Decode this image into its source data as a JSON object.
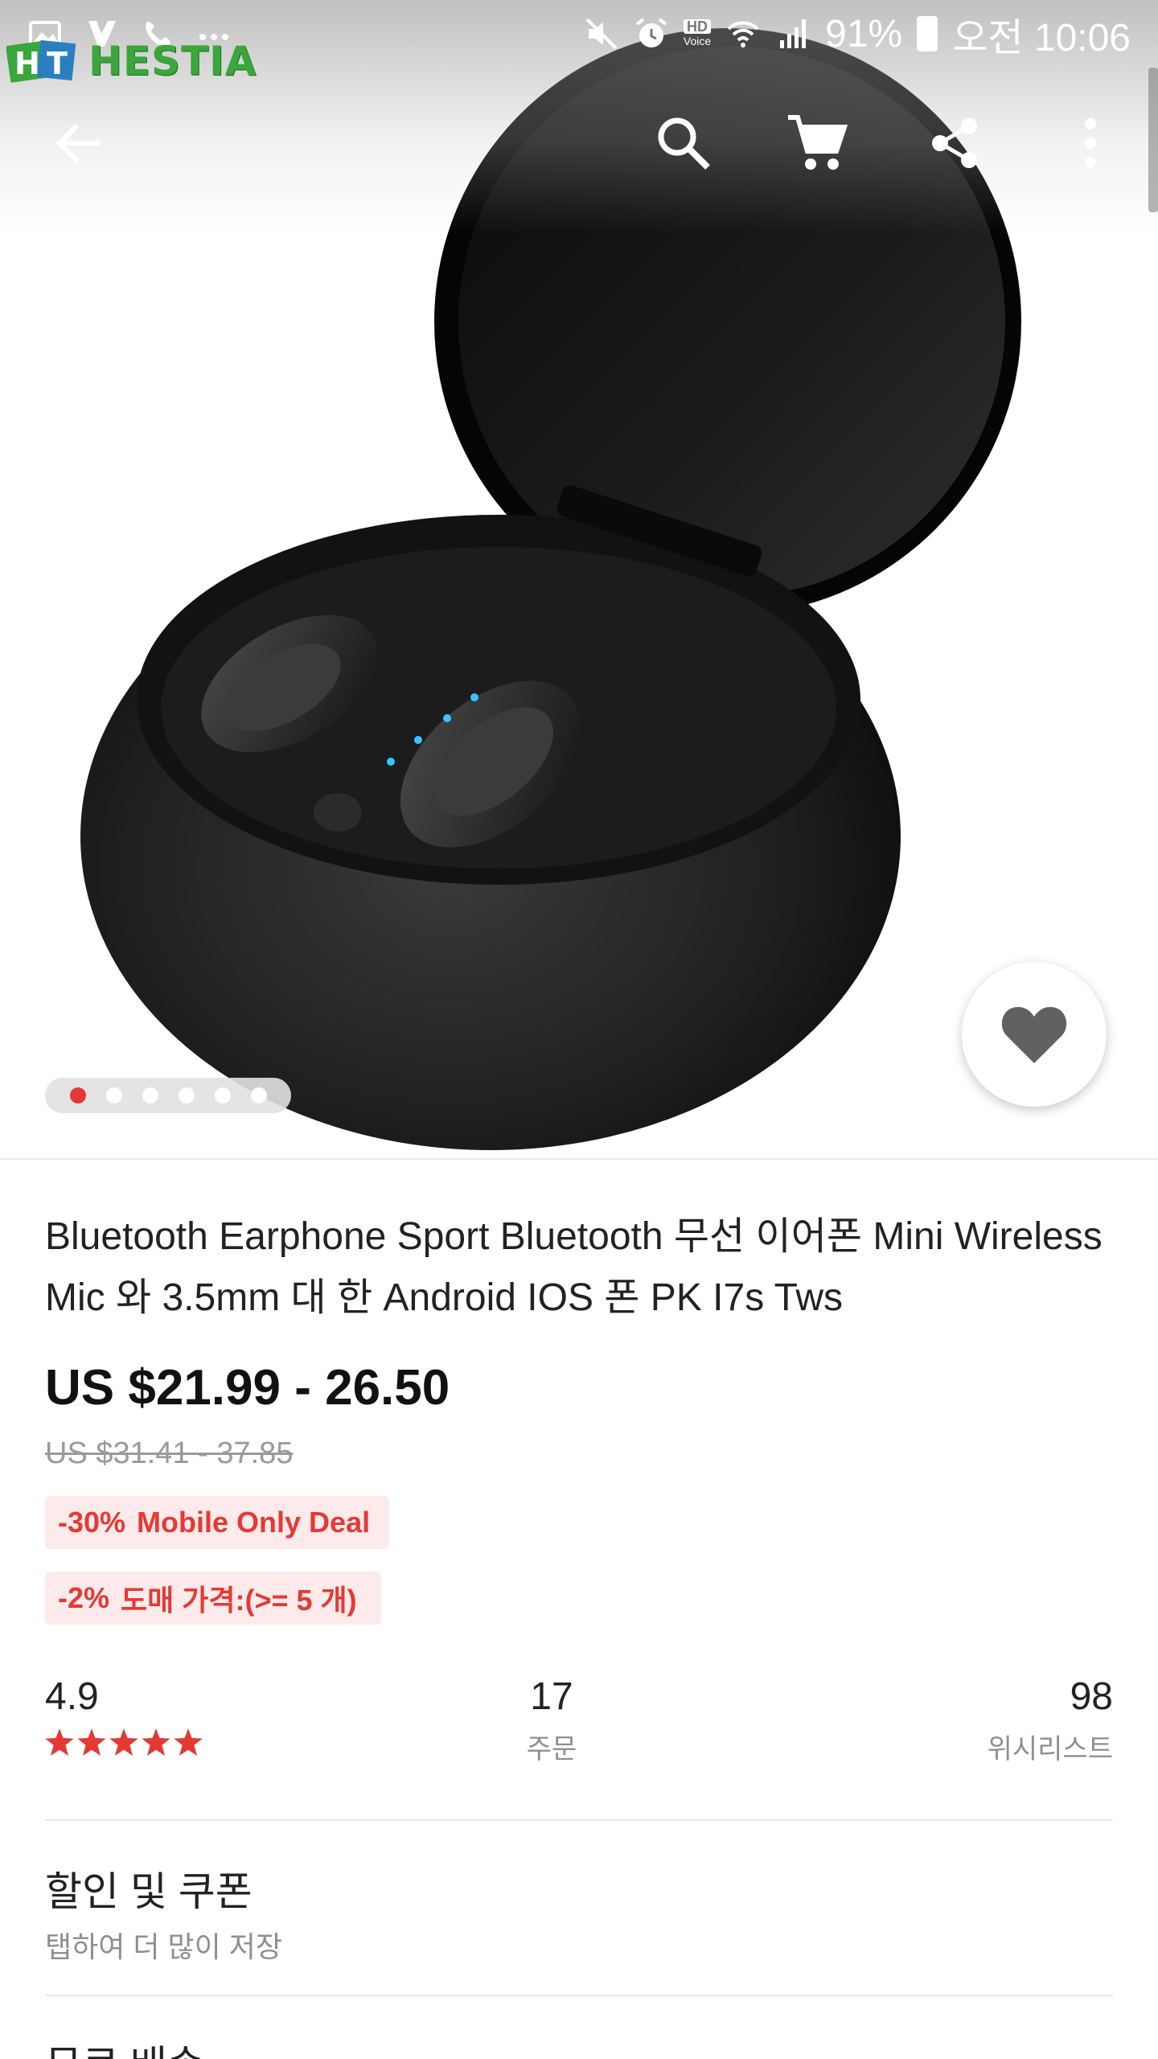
{
  "status_bar": {
    "battery": "91%",
    "time": "오전 10:06",
    "hd_voice": "HD Voice"
  },
  "watermark": {
    "text": "HESTIA",
    "badge": "HT"
  },
  "toolbar": {
    "icons": [
      "back-arrow-icon",
      "search-icon",
      "cart-icon",
      "share-icon",
      "more-vert-icon"
    ]
  },
  "gallery": {
    "image_count": 6,
    "active_index": 0
  },
  "product": {
    "title": "Bluetooth Earphone Sport Bluetooth 무선 이어폰 Mini Wireless Mic 와 3.5mm 대 한 Android IOS 폰 PK I7s Tws",
    "price": "US $21.99 - 26.50",
    "original_price": "US $31.41 - 37.85",
    "tags": [
      {
        "percent": "-30%",
        "label": "Mobile Only Deal"
      },
      {
        "percent": "-2%",
        "label": "도매 가격:(>= 5 개)"
      }
    ]
  },
  "stats": {
    "rating": "4.9",
    "stars": 5,
    "orders": "17",
    "orders_label": "주문",
    "wishlist": "98",
    "wishlist_label": "위시리스트"
  },
  "sections": {
    "coupon_title": "할인 및 쿠폰",
    "coupon_sub": "탭하여 더 많이 저장",
    "shipping_title": "무료 배송"
  },
  "colors": {
    "accent": "#e53935",
    "tag_bg": "#fdeaea"
  }
}
